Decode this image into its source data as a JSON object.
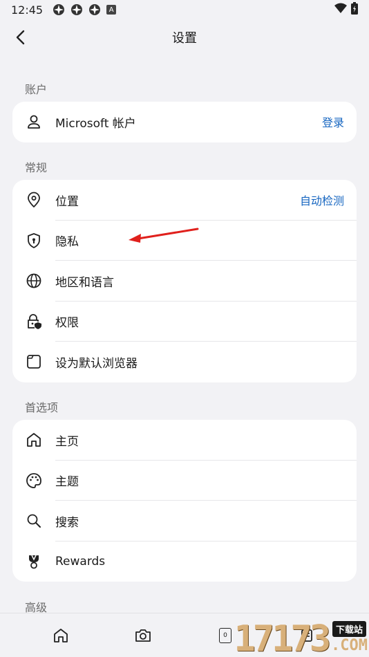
{
  "status_bar": {
    "time": "12:45",
    "notification_badge": "A"
  },
  "header": {
    "title": "设置"
  },
  "sections": {
    "account": {
      "label": "账户",
      "items": [
        {
          "label": "Microsoft 帐户",
          "action": "登录",
          "icon": "person-icon"
        }
      ]
    },
    "general": {
      "label": "常规",
      "items": [
        {
          "label": "位置",
          "action": "自动检测",
          "icon": "location-pin-icon"
        },
        {
          "label": "隐私",
          "icon": "shield-lock-icon"
        },
        {
          "label": "地区和语言",
          "icon": "globe-icon"
        },
        {
          "label": "权限",
          "icon": "lock-shield-icon"
        },
        {
          "label": "设为默认浏览器",
          "icon": "browser-window-icon"
        }
      ]
    },
    "preferences": {
      "label": "首选项",
      "items": [
        {
          "label": "主页",
          "icon": "home-icon"
        },
        {
          "label": "主题",
          "icon": "palette-icon"
        },
        {
          "label": "搜索",
          "icon": "search-icon"
        },
        {
          "label": "Rewards",
          "icon": "trophy-icon"
        }
      ]
    },
    "advanced": {
      "label": "高级"
    }
  },
  "bottom_nav": {
    "tab_count": "0"
  },
  "watermark": {
    "digits": "17173",
    "top_text": "下载站",
    "domain": ".COM"
  },
  "colors": {
    "accent": "#1565c0",
    "background": "#f2f2f5",
    "card": "#ffffff",
    "annotation_arrow": "#e0201c"
  }
}
